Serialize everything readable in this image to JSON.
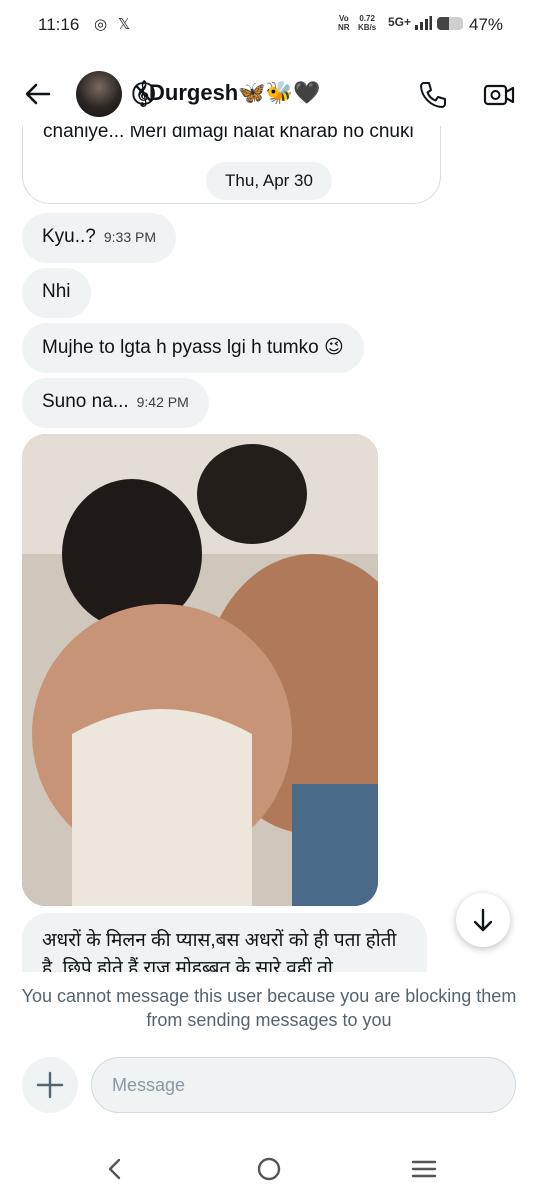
{
  "status_bar": {
    "time": "11:16",
    "volte": "Vo\nNR",
    "speed": "0.72\nKB/s",
    "network": "5G+",
    "battery_level": 0.47,
    "battery_pct": "47%"
  },
  "header": {
    "contact_name": "𝄞⃠Durgesh🦋🐝🖤",
    "icons": [
      "arrow-left-icon",
      "phone-icon",
      "video-camera-icon"
    ]
  },
  "messages": {
    "top_text": "chahiye... Meri dimagi halat kharab ho chuki",
    "date_chip": "Thu, Apr 30",
    "items": [
      {
        "text": "Kyu..?",
        "time": "9:33 PM"
      },
      {
        "text": "Nhi",
        "time": ""
      },
      {
        "text": "Mujhe to lgta h pyass lgi h tumko 😉",
        "time": ""
      },
      {
        "text": "Suno na...",
        "time": "9:42 PM"
      }
    ],
    "hindi_text": "अधरों के मिलन की प्यास,बस अधरों को ही पता होती है..छिपे होते हैं राज मोहब्बत के सारे.वहीं तो"
  },
  "notice": "You cannot message this user because you are blocking them from sending messages to you",
  "composer": {
    "placeholder": "Message"
  },
  "colors": {
    "bubble_bg": "#eff3f4",
    "notice_text": "#536471",
    "text": "#0f1419"
  }
}
